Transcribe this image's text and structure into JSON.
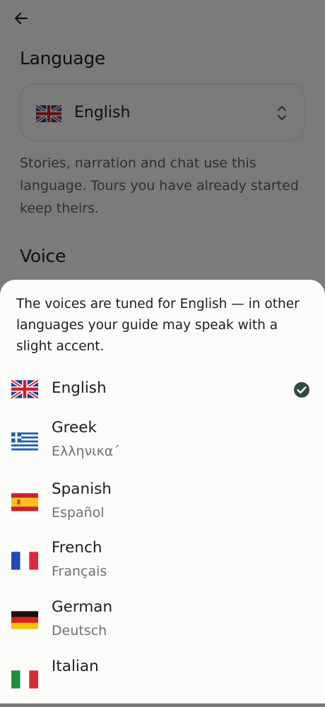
{
  "settings": {
    "language_title": "Language",
    "selected_language": "English",
    "language_help": "Stories, narration and chat use this language. Tours you have already started keep theirs.",
    "voice_title": "Voice"
  },
  "sheet": {
    "note": "The voices are tuned for English — in other languages your guide may speak with a slight accent.",
    "languages": [
      {
        "name": "English",
        "native": "",
        "flag": "uk-flag",
        "selected": true
      },
      {
        "name": "Greek",
        "native": "Ελληνικα´",
        "flag": "greece-flag",
        "selected": false
      },
      {
        "name": "Spanish",
        "native": "Español",
        "flag": "spain-flag",
        "selected": false
      },
      {
        "name": "French",
        "native": "Français",
        "flag": "france-flag",
        "selected": false
      },
      {
        "name": "German",
        "native": "Deutsch",
        "flag": "germany-flag",
        "selected": false
      },
      {
        "name": "Italian",
        "native": "",
        "flag": "italy-flag",
        "selected": false
      }
    ]
  },
  "colors": {
    "check": "#2f4b40",
    "scrim": "rgba(0,0,0,0.5)"
  }
}
